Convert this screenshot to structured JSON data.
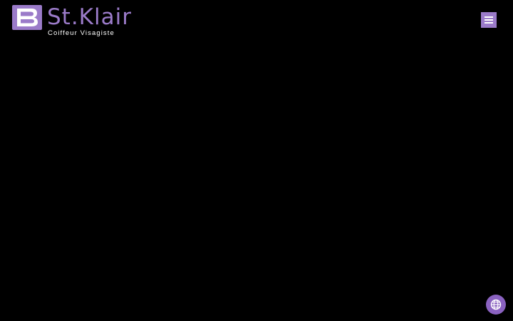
{
  "header": {
    "logo": {
      "mark_letter": "B",
      "name": "St.Klair",
      "tagline": "Coiffeur Visagiste"
    },
    "menu_button_icon": "hamburger-menu-icon"
  },
  "floating": {
    "language_button_icon": "globe-icon"
  },
  "colors": {
    "background": "#000000",
    "brand_purple": "#9b7bc9",
    "globe_button": "#8a62c0",
    "tagline": "#ffffff"
  }
}
